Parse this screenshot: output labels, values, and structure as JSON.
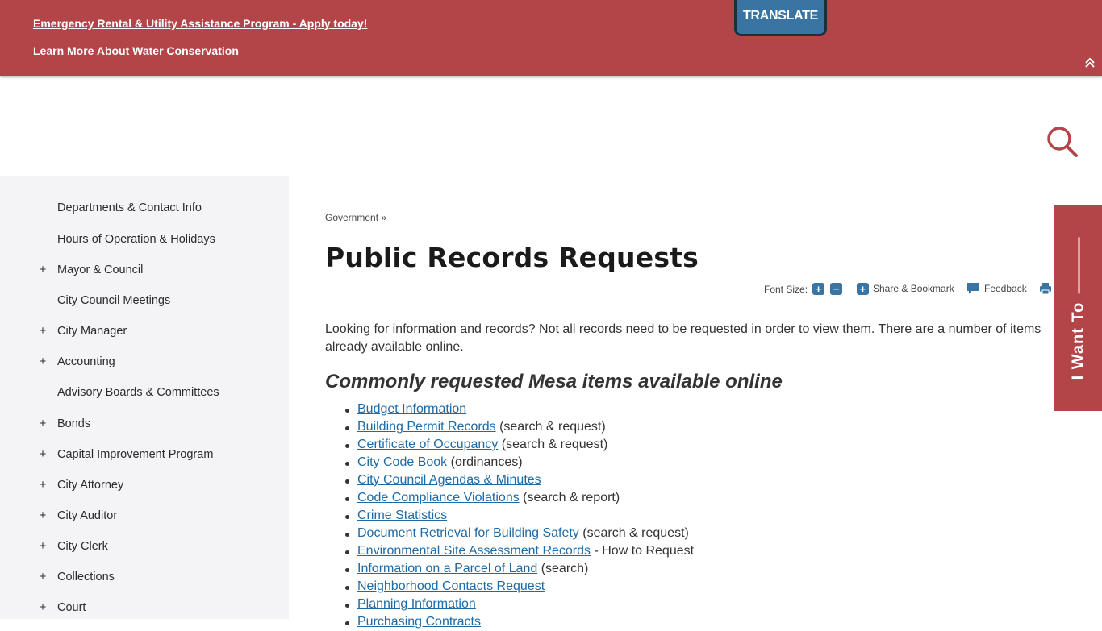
{
  "alerts": [
    {
      "label": "Emergency Rental & Utility Assistance Program - Apply today!"
    },
    {
      "label": "Learn More About Water Conservation"
    }
  ],
  "translate_label": "TRANSLATE",
  "collapse_icon": "double-chevron-up",
  "colors": {
    "brand_red": "#b34548",
    "accent_blue": "#3a74a2",
    "link_blue": "#1f6aa5"
  },
  "sidebar": {
    "items": [
      {
        "label": "Departments & Contact Info",
        "expandable": false
      },
      {
        "label": "Hours of Operation & Holidays",
        "expandable": false
      },
      {
        "label": "Mayor & Council",
        "expandable": true
      },
      {
        "label": "City Council Meetings",
        "expandable": false
      },
      {
        "label": "City Manager",
        "expandable": true
      },
      {
        "label": "Accounting",
        "expandable": true
      },
      {
        "label": "Advisory Boards & Committees",
        "expandable": false
      },
      {
        "label": "Bonds",
        "expandable": true
      },
      {
        "label": "Capital Improvement Program",
        "expandable": true
      },
      {
        "label": "City Attorney",
        "expandable": true
      },
      {
        "label": "City Auditor",
        "expandable": true
      },
      {
        "label": "City Clerk",
        "expandable": true
      },
      {
        "label": "Collections",
        "expandable": true
      },
      {
        "label": "Court",
        "expandable": true
      }
    ],
    "expand_symbol": "+"
  },
  "breadcrumb": {
    "parent": "Government",
    "separator": "»"
  },
  "page_title": "Public Records Requests",
  "tools": {
    "font_size_label": "Font Size:",
    "increase_symbol": "+",
    "decrease_symbol": "−",
    "share_label": "Share & Bookmark",
    "feedback_label": "Feedback"
  },
  "intro": "Looking for information and records? Not all records need to be requested in order to view them. There are a number of items already available online.",
  "section_title": "Commonly requested Mesa items available online",
  "links": [
    {
      "link": "Budget Information",
      "note": ""
    },
    {
      "link": "Building Permit Records",
      "note": " (search & request)"
    },
    {
      "link": "Certificate of Occupancy",
      "note": " (search & request)"
    },
    {
      "link": "City Code Book",
      "note": " (ordinances)"
    },
    {
      "link": "City Council Agendas & Minutes",
      "note": ""
    },
    {
      "link": "Code Compliance Violations",
      "note": " (search & report)"
    },
    {
      "link": "Crime Statistics",
      "note": ""
    },
    {
      "link": "Document Retrieval for Building Safety",
      "note": " (search & request)"
    },
    {
      "link": "Environmental Site Assessment Records",
      "note": " - How to Request"
    },
    {
      "link": "Information on a Parcel of Land",
      "note": " (search)"
    },
    {
      "link": "Neighborhood Contacts Request",
      "note": ""
    },
    {
      "link": "Planning Information",
      "note": ""
    },
    {
      "link": "Purchasing Contracts",
      "note": ""
    }
  ],
  "i_want_to_label": "I Want To"
}
